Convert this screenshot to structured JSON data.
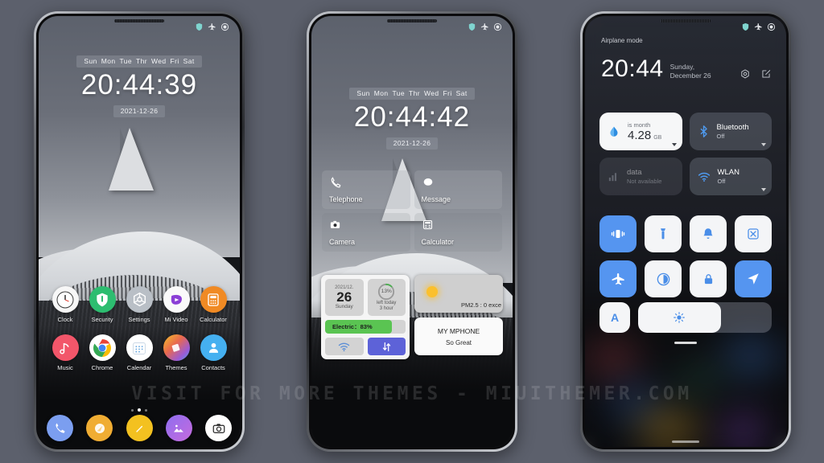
{
  "watermark": "VISIT FOR MORE THEMES - MIUITHEMER.COM",
  "colors": {
    "page_background": "#5c606c",
    "accent_blue": "#5595f0",
    "battery_green": "#5ac452",
    "data_tile_purple": "#5d62d8"
  },
  "status_bar": {
    "icons": [
      "shield-icon",
      "airplane-icon",
      "battery-icon"
    ]
  },
  "phone1": {
    "name": "lockscreen",
    "week_days": [
      "Sun",
      "Mon",
      "Tue",
      "Thr",
      "Wed",
      "Fri",
      "Sat"
    ],
    "clock": "20:44:39",
    "date": "2021-12-26",
    "apps_row1": [
      {
        "label": "Clock",
        "icon": "clock-icon",
        "bg": "#f7f7f7"
      },
      {
        "label": "Security",
        "icon": "shield-icon",
        "bg": "#2dbd70"
      },
      {
        "label": "Settings",
        "icon": "gear-icon",
        "bg": "#b9bfc6"
      },
      {
        "label": "Mi Video",
        "icon": "play-icon",
        "bg": "#fafafa"
      },
      {
        "label": "Calculator",
        "icon": "calculator-icon",
        "bg": "#f08a24"
      }
    ],
    "apps_row2": [
      {
        "label": "Music",
        "icon": "music-note-icon",
        "bg": "#f2566a"
      },
      {
        "label": "Chrome",
        "icon": "chrome-icon",
        "bg": "#ffffff"
      },
      {
        "label": "Calendar",
        "icon": "calendar-icon",
        "bg": "#ffffff"
      },
      {
        "label": "Themes",
        "icon": "themes-icon",
        "bg": "#e9a13b"
      },
      {
        "label": "Contacts",
        "icon": "contact-icon",
        "bg": "#45b0f0"
      }
    ],
    "page_dots": 3,
    "active_dot": 2,
    "dock": [
      {
        "label": "Phone",
        "icon": "phone-icon",
        "bg": "#7b9ef0"
      },
      {
        "label": "Browser",
        "icon": "browser-icon",
        "bg": "#f0ad33"
      },
      {
        "label": "Notes",
        "icon": "notes-icon",
        "bg": "#f3c120"
      },
      {
        "label": "Gallery",
        "icon": "gallery-icon",
        "bg": "#a368e8"
      },
      {
        "label": "Camera",
        "icon": "camera-icon",
        "bg": "#ffffff"
      }
    ]
  },
  "phone2": {
    "name": "homescreen-widgets",
    "week_days": [
      "Sun",
      "Mon",
      "Tue",
      "Thr",
      "Wed",
      "Fri",
      "Sat"
    ],
    "clock": "20:44:42",
    "date": "2021-12-26",
    "shortcuts": [
      {
        "label": "Telephone",
        "icon": "phone-icon"
      },
      {
        "label": "Message",
        "icon": "message-icon"
      },
      {
        "label": "Camera",
        "icon": "camera-icon"
      },
      {
        "label": "Calculator",
        "icon": "calculator-icon"
      }
    ],
    "date_tile": {
      "year_month": "2021/12.",
      "day": "26",
      "weekday": "Sunday"
    },
    "progress_tile": {
      "percent": "13%",
      "value": 13,
      "line1": "left today",
      "line2": "3 hour"
    },
    "battery_tile": {
      "label": "Electric：83%",
      "percent": 83
    },
    "wifi_tile": {
      "icon": "wifi-icon",
      "active": false
    },
    "data_tile": {
      "icon": "data-transfer-icon",
      "active": true
    },
    "weather_card": {
      "icon": "sun-icon",
      "text": "PM2.5 : 0 exce"
    },
    "name_card": {
      "line1": "MY MPHONE",
      "line2": "So Great"
    }
  },
  "phone3": {
    "name": "control-center",
    "airplane_label": "Airplane mode",
    "time": "20:44",
    "date": "Sunday, December 26",
    "header_actions": [
      "gear-icon",
      "edit-icon"
    ],
    "cards": [
      {
        "id": "data-usage",
        "style": "light",
        "title": "is month",
        "value": "4.28",
        "unit": "GB",
        "icon": "data-drop-icon",
        "caret": true
      },
      {
        "id": "bluetooth",
        "style": "dark",
        "title": "Bluetooth",
        "subtitle": "Off",
        "icon": "bluetooth-icon",
        "caret": true
      },
      {
        "id": "mobile-data",
        "style": "dim",
        "title": "data",
        "subtitle": "Not available",
        "icon": "signal-icon",
        "caret": false
      },
      {
        "id": "wlan",
        "style": "dark",
        "title": "WLAN",
        "subtitle": "Off",
        "icon": "wifi-icon",
        "caret": true
      }
    ],
    "quick_toggles": [
      {
        "id": "vibrate",
        "icon": "vibrate-icon",
        "on": true
      },
      {
        "id": "flashlight",
        "icon": "flashlight-icon",
        "on": false
      },
      {
        "id": "ringer",
        "icon": "bell-icon",
        "on": false
      },
      {
        "id": "screenshot",
        "icon": "scissors-icon",
        "on": false
      },
      {
        "id": "airplane",
        "icon": "airplane-icon",
        "on": true
      },
      {
        "id": "dark-mode",
        "icon": "contrast-icon",
        "on": false
      },
      {
        "id": "lock",
        "icon": "lock-icon",
        "on": false
      },
      {
        "id": "location",
        "icon": "location-icon",
        "on": true
      }
    ],
    "auto_brightness_label": "A",
    "brightness": {
      "icon": "brightness-icon",
      "percent": 62
    }
  }
}
